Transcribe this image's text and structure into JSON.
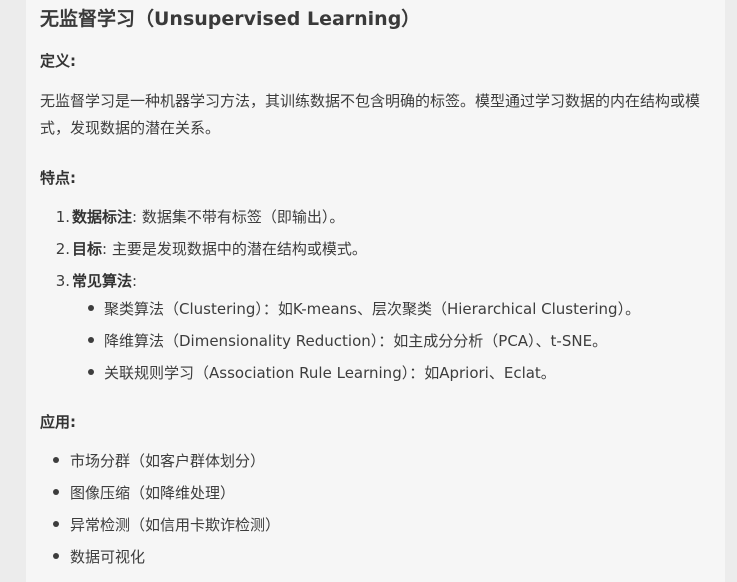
{
  "title": "无监督学习（Unsupervised Learning）",
  "definition": {
    "label": "定义:",
    "text": "无监督学习是一种机器学习方法，其训练数据不包含明确的标签。模型通过学习数据的内在结构或模式，发现数据的潜在关系。"
  },
  "features": {
    "label": "特点:",
    "items": [
      {
        "num": "1.",
        "term": "数据标注",
        "text": ": 数据集不带有标签（即输出）。"
      },
      {
        "num": "2.",
        "term": "目标",
        "text": ": 主要是发现数据中的潜在结构或模式。"
      },
      {
        "num": "3.",
        "term": "常见算法",
        "text": ":"
      }
    ],
    "algorithms": [
      "聚类算法（Clustering）：如K-means、层次聚类（Hierarchical Clustering）。",
      "降维算法（Dimensionality Reduction）：如主成分分析（PCA）、t-SNE。",
      "关联规则学习（Association Rule Learning）：如Apriori、Eclat。"
    ]
  },
  "applications": {
    "label": "应用:",
    "items": [
      "市场分群（如客户群体划分）",
      "图像压缩（如降维处理）",
      "异常检测（如信用卡欺诈检测）",
      "数据可视化"
    ]
  }
}
